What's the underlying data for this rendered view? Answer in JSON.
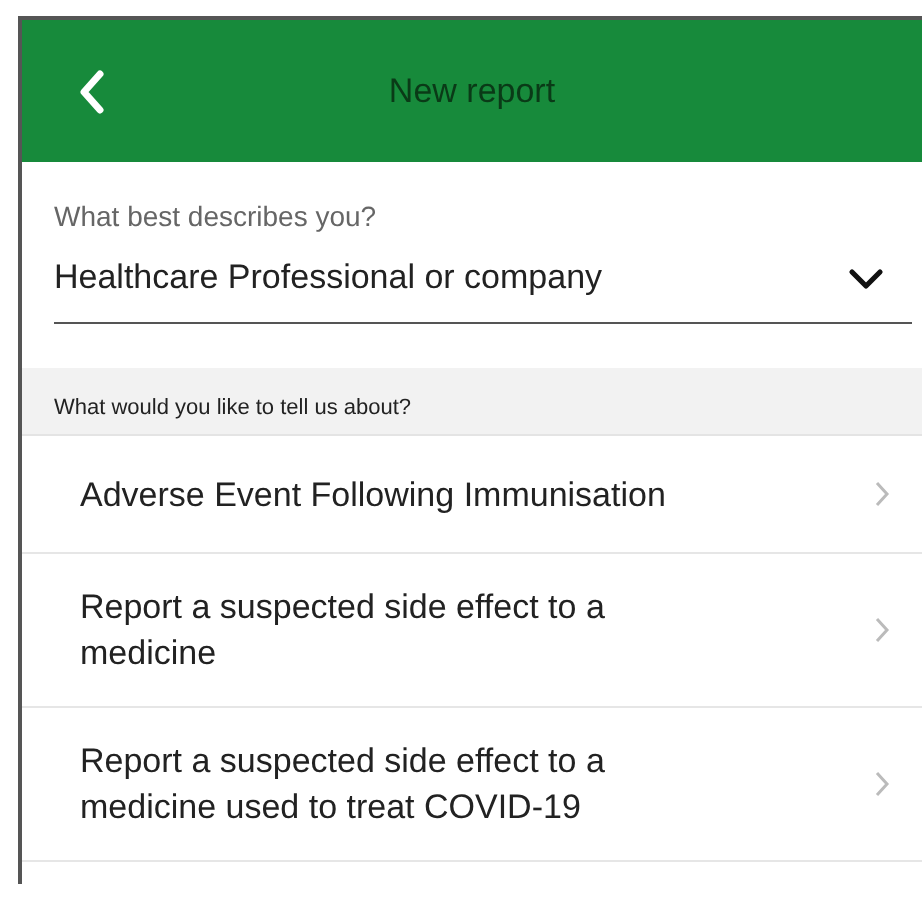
{
  "header": {
    "title": "New report"
  },
  "describe": {
    "label": "What best describes you?",
    "value": "Healthcare Professional or company"
  },
  "section": {
    "title": "What would you like to tell us about?"
  },
  "options": [
    {
      "label": "Adverse Event Following Immunisation"
    },
    {
      "label": "Report a suspected side effect to a medicine"
    },
    {
      "label": "Report a suspected side effect to a medicine used to treat COVID-19"
    }
  ]
}
